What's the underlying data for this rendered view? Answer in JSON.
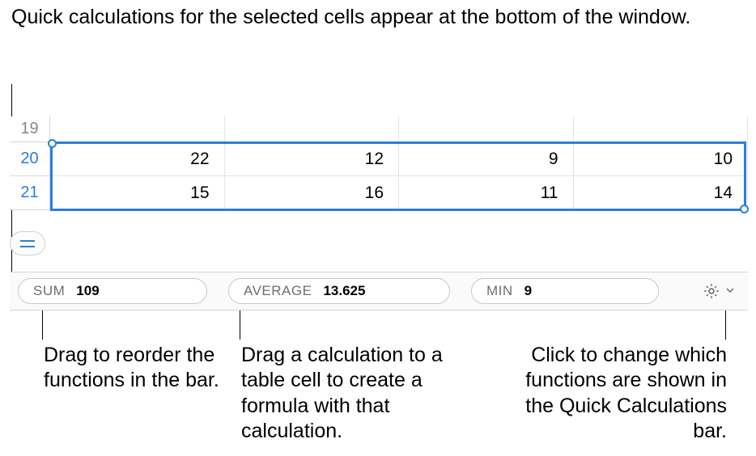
{
  "annotations": {
    "top": "Quick calculations for the selected cells appear at the bottom of the window.",
    "reorder": "Drag to reorder the functions in the bar.",
    "drag_to_cell": "Drag a calculation to a table cell to create a formula with that calculation.",
    "gear": "Click to change which functions are shown in the Quick Calculations bar."
  },
  "rows": {
    "r19": {
      "num": "19"
    },
    "r20": {
      "num": "20",
      "c0": "22",
      "c1": "12",
      "c2": "9",
      "c3": "10"
    },
    "r21": {
      "num": "21",
      "c0": "15",
      "c1": "16",
      "c2": "11",
      "c3": "14"
    }
  },
  "calc": {
    "sum": {
      "label": "SUM",
      "value": "109"
    },
    "avg": {
      "label": "AVERAGE",
      "value": "13.625"
    },
    "min": {
      "label": "MIN",
      "value": "9"
    }
  }
}
